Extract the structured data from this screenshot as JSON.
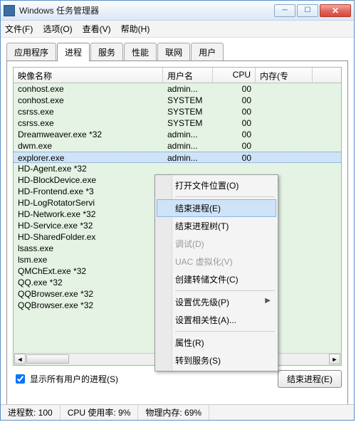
{
  "window": {
    "title": "Windows 任务管理器"
  },
  "menu": {
    "file": "文件(F)",
    "options": "选项(O)",
    "view": "查看(V)",
    "help": "帮助(H)"
  },
  "tabs": {
    "apps": "应用程序",
    "procs": "进程",
    "svcs": "服务",
    "perf": "性能",
    "net": "联网",
    "users": "用户"
  },
  "cols": {
    "image": "映像名称",
    "user": "用户名",
    "cpu": "CPU",
    "mem": "内存(专"
  },
  "rows": [
    {
      "img": "conhost.exe",
      "user": "admin...",
      "cpu": "00"
    },
    {
      "img": "conhost.exe",
      "user": "SYSTEM",
      "cpu": "00"
    },
    {
      "img": "csrss.exe",
      "user": "SYSTEM",
      "cpu": "00"
    },
    {
      "img": "csrss.exe",
      "user": "SYSTEM",
      "cpu": "00"
    },
    {
      "img": "Dreamweaver.exe *32",
      "user": "admin...",
      "cpu": "00"
    },
    {
      "img": "dwm.exe",
      "user": "admin...",
      "cpu": "00"
    },
    {
      "img": "explorer.exe",
      "user": "admin...",
      "cpu": "00",
      "sel": true
    },
    {
      "img": "HD-Agent.exe *32",
      "user": "",
      "cpu": ""
    },
    {
      "img": "HD-BlockDevice.exe",
      "user": "",
      "cpu": ""
    },
    {
      "img": "HD-Frontend.exe *3",
      "user": "",
      "cpu": ""
    },
    {
      "img": "HD-LogRotatorServi",
      "user": "",
      "cpu": ""
    },
    {
      "img": "HD-Network.exe *32",
      "user": "",
      "cpu": ""
    },
    {
      "img": "HD-Service.exe *32",
      "user": "",
      "cpu": ""
    },
    {
      "img": "HD-SharedFolder.ex",
      "user": "",
      "cpu": ""
    },
    {
      "img": "lsass.exe",
      "user": "",
      "cpu": ""
    },
    {
      "img": "lsm.exe",
      "user": "",
      "cpu": ""
    },
    {
      "img": "QMChExt.exe *32",
      "user": "",
      "cpu": ""
    },
    {
      "img": "QQ.exe *32",
      "user": "",
      "cpu": ""
    },
    {
      "img": "QQBrowser.exe *32",
      "user": "",
      "cpu": ""
    },
    {
      "img": "QQBrowser.exe *32",
      "user": "",
      "cpu": ""
    }
  ],
  "check": {
    "label": "显示所有用户的进程(S)",
    "checked": true
  },
  "endbtn": "结束进程(E)",
  "status": {
    "procs": "进程数: 100",
    "cpu": "CPU 使用率: 9%",
    "mem": "物理内存: 69%"
  },
  "ctx": {
    "open": "打开文件位置(O)",
    "end": "结束进程(E)",
    "endtree": "结束进程树(T)",
    "debug": "调试(D)",
    "uac": "UAC 虚拟化(V)",
    "dump": "创建转储文件(C)",
    "prio": "设置优先级(P)",
    "affinity": "设置相关性(A)...",
    "props": "属性(R)",
    "gotosvc": "转到服务(S)"
  }
}
